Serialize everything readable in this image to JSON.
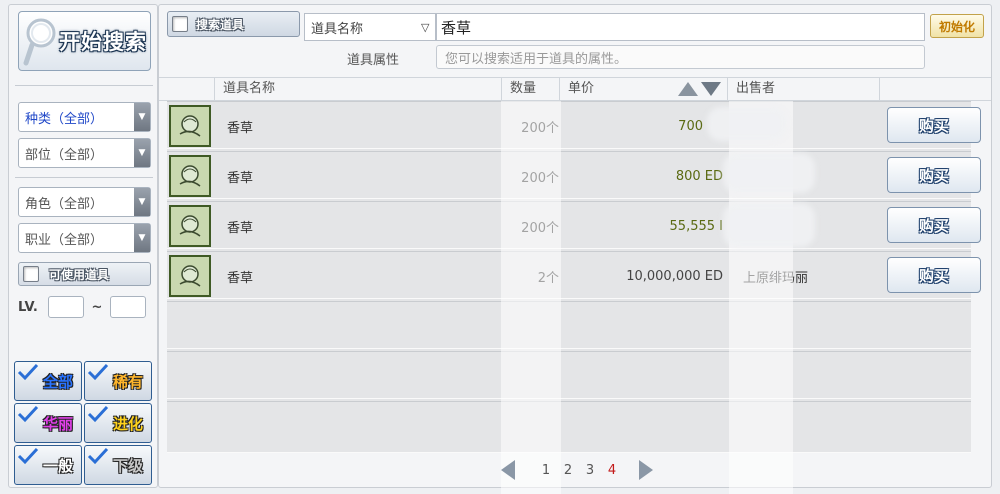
{
  "left_panel": {
    "start_search_label": "开始搜索",
    "dropdowns": [
      "种类（全部）",
      "部位（全部）",
      "角色（全部）",
      "职业（全部）"
    ],
    "usable_items_label": "可使用道具",
    "lv_label": "LV.",
    "lv_separator": "~",
    "grades": [
      {
        "label": "全部",
        "color": "#2a74ff"
      },
      {
        "label": "稀有",
        "color": "#ffb62c"
      },
      {
        "label": "华丽",
        "color": "#e040e8"
      },
      {
        "label": "进化",
        "color": "#ffd21c"
      },
      {
        "label": "一般",
        "color": "#ffffff"
      },
      {
        "label": "下级",
        "color": "#c8c8c8"
      }
    ]
  },
  "search": {
    "search_items_label": "搜索道具",
    "field_select": "道具名称",
    "keyword": "香草",
    "init_label": "初始化",
    "attr_label": "道具属性",
    "attr_placeholder": "您可以搜索适用于道具的属性。"
  },
  "table": {
    "headers": {
      "name": "道具名称",
      "qty": "数量",
      "price": "单价",
      "seller": "出售者"
    },
    "rows": [
      {
        "name": "香草",
        "qty": "200个",
        "price": "700",
        "seller": "",
        "buy": "购买"
      },
      {
        "name": "香草",
        "qty": "200个",
        "price": "800 ED",
        "seller": "",
        "buy": "购买"
      },
      {
        "name": "香草",
        "qty": "200个",
        "price": "55,555 I",
        "seller": "",
        "buy": "购买"
      },
      {
        "name": "香草",
        "qty": "2个",
        "price": "10,000,000 ED",
        "seller": "上原绯玛丽",
        "buy": "购买"
      }
    ]
  },
  "pager": {
    "pages": [
      "1",
      "2",
      "3",
      "4"
    ],
    "current": "4"
  }
}
